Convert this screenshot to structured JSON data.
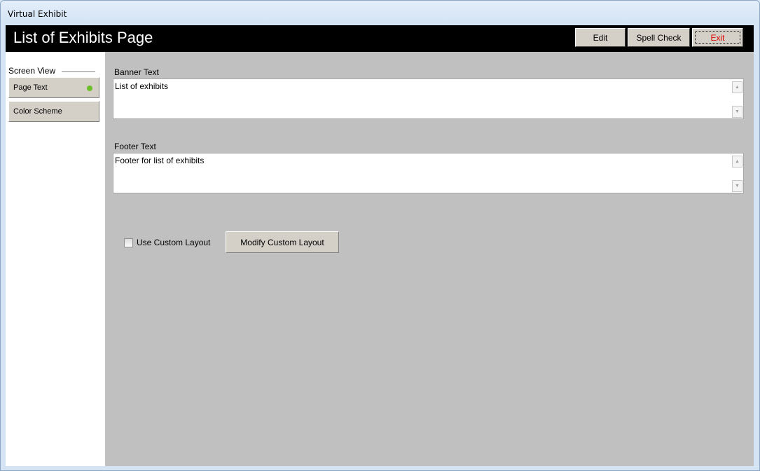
{
  "window": {
    "title": "Virtual Exhibit"
  },
  "header": {
    "title": "List of Exhibits Page",
    "buttons": {
      "edit": "Edit",
      "spell_check": "Spell Check",
      "exit": "Exit"
    }
  },
  "sidebar": {
    "group_label": "Screen View",
    "items": [
      {
        "label": "Page Text",
        "selected": true,
        "indicator_color": "#6cbf2a"
      },
      {
        "label": "Color Scheme",
        "selected": false
      }
    ]
  },
  "fields": {
    "banner": {
      "label": "Banner Text",
      "value": "List of exhibits"
    },
    "footer": {
      "label": "Footer Text",
      "value": "Footer for list of exhibits"
    }
  },
  "custom_layout": {
    "checkbox_label": "Use Custom Layout",
    "checked": false,
    "button_label": "Modify Custom Layout"
  },
  "colors": {
    "header_bg": "#000000",
    "content_bg": "#c0c0c0",
    "exit_text": "#e00000"
  }
}
